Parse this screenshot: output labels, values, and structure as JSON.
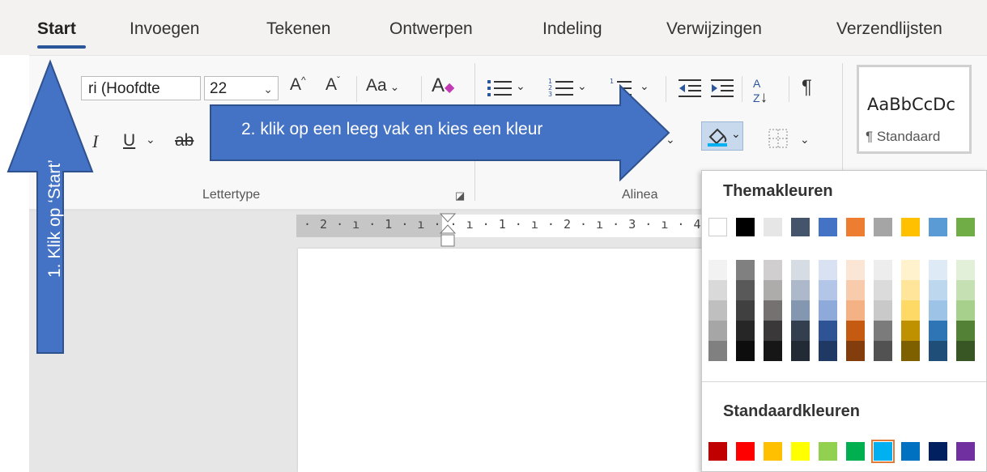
{
  "tabs": [
    {
      "label": "Start",
      "active": true
    },
    {
      "label": "Invoegen"
    },
    {
      "label": "Tekenen"
    },
    {
      "label": "Ontwerpen"
    },
    {
      "label": "Indeling"
    },
    {
      "label": "Verwijzingen"
    },
    {
      "label": "Verzendlijsten"
    }
  ],
  "ribbon": {
    "font_name": "ri (Hoofdte",
    "font_size": "22",
    "grow_font": "A",
    "shrink_font": "A",
    "change_case": "Aa",
    "styles_sample": "AaBbCcDc",
    "styles_name": "¶ Standaard",
    "groups": {
      "font": "Lettertype",
      "paragraph": "Alinea"
    }
  },
  "ruler": {
    "ticks": "· 2 · ı · 1 · ı ·   · ı · 1 · ı · 2 · ı · 3 · ı · 4"
  },
  "annotations": {
    "step1": "1.  Klik op ‘Start’",
    "step2": "2. klik op een leeg vak en kies een kleur"
  },
  "color_panel": {
    "theme_heading": "Themakleuren",
    "standard_heading": "Standaardkleuren",
    "theme_top": [
      "#ffffff",
      "#000000",
      "#e7e6e6",
      "#44546a",
      "#4472c4",
      "#ed7d31",
      "#a5a5a5",
      "#ffc000",
      "#5b9bd5",
      "#70ad47"
    ],
    "theme_shades": [
      [
        "#f2f2f2",
        "#d9d9d9",
        "#bfbfbf",
        "#a6a6a6",
        "#808080"
      ],
      [
        "#808080",
        "#595959",
        "#404040",
        "#262626",
        "#0d0d0d"
      ],
      [
        "#d0cece",
        "#aeabab",
        "#757171",
        "#3a3838",
        "#171616"
      ],
      [
        "#d6dce4",
        "#adb9ca",
        "#8497b0",
        "#333f4f",
        "#222a35"
      ],
      [
        "#d9e2f3",
        "#b4c6e7",
        "#8eaadb",
        "#2f5496",
        "#1f3864"
      ],
      [
        "#fbe5d5",
        "#f8cbad",
        "#f4b183",
        "#c55a11",
        "#833c0b"
      ],
      [
        "#ededed",
        "#dbdbdb",
        "#c9c9c9",
        "#7b7b7b",
        "#525252"
      ],
      [
        "#fff2cc",
        "#ffe599",
        "#ffd966",
        "#bf9000",
        "#7f6000"
      ],
      [
        "#deebf6",
        "#bdd7ee",
        "#9dc3e6",
        "#2e75b5",
        "#1f4e79"
      ],
      [
        "#e2efd9",
        "#c5e0b3",
        "#a8d08d",
        "#538135",
        "#375623"
      ]
    ],
    "standard": [
      "#c00000",
      "#ff0000",
      "#ffc000",
      "#ffff00",
      "#92d050",
      "#00b050",
      "#00b0f0",
      "#0070c0",
      "#002060",
      "#7030a0"
    ],
    "selected_standard": 6
  },
  "colors": {
    "accent": "#2b579a",
    "arrow_fill": "#4472c4",
    "arrow_stroke": "#2f528f"
  }
}
